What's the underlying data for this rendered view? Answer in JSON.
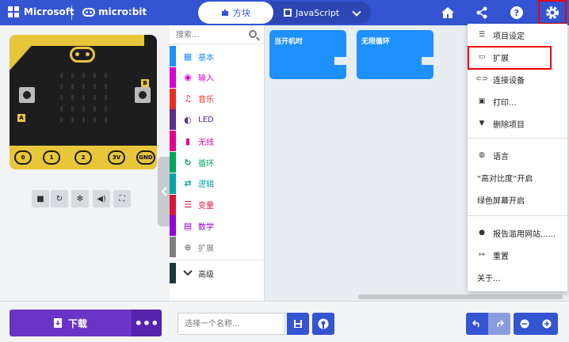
{
  "header": {
    "brand": "Microsoft",
    "product": "micro:bit",
    "tab_blocks": "方块",
    "tab_js": "JavaScript",
    "icons": [
      "home-icon",
      "share-icon",
      "help-icon",
      "gear-icon"
    ]
  },
  "toolbox": {
    "search_placeholder": "搜索...",
    "categories": [
      {
        "label": "基本",
        "color": "#1e90ff",
        "icon": "grid"
      },
      {
        "label": "输入",
        "color": "#d400d4",
        "icon": "circle"
      },
      {
        "label": "音乐",
        "color": "#e63022",
        "icon": "headphones"
      },
      {
        "label": "LED",
        "color": "#5c2d91",
        "icon": "toggle"
      },
      {
        "label": "无线",
        "color": "#e3008c",
        "icon": "signal"
      },
      {
        "label": "循环",
        "color": "#00a65a",
        "icon": "loop"
      },
      {
        "label": "逻辑",
        "color": "#00a4a6",
        "icon": "shuffle"
      },
      {
        "label": "变量",
        "color": "#dc143c",
        "icon": "list"
      },
      {
        "label": "数学",
        "color": "#9400d3",
        "icon": "calculator"
      },
      {
        "label": "扩展",
        "color": "#7f7f7f",
        "icon": "plus"
      }
    ],
    "advanced": {
      "label": "高级",
      "color": "#1a3a3a"
    }
  },
  "workspace": {
    "blocks": [
      {
        "label": "当开机时",
        "color": "#1e90ff"
      },
      {
        "label": "无限循环",
        "color": "#1e90ff"
      }
    ]
  },
  "settings_menu": {
    "items": [
      {
        "label": "项目设定",
        "icon": "sliders-icon"
      },
      {
        "label": "扩展",
        "icon": "drive-icon"
      },
      {
        "label": "连接设备",
        "icon": "link-icon"
      },
      {
        "label": "打印...",
        "icon": "print-icon"
      },
      {
        "label": "删除项目",
        "icon": "trash-icon"
      },
      {
        "label": "语言",
        "icon": "globe-icon"
      },
      {
        "label": "“高对比度”开启",
        "icon": ""
      },
      {
        "label": "绿色屏幕开启",
        "icon": ""
      },
      {
        "label": "报告滥用网站......",
        "icon": "alert-icon"
      },
      {
        "label": "重置",
        "icon": "signout-icon"
      },
      {
        "label": "关于...",
        "icon": ""
      }
    ]
  },
  "simulator": {
    "pins": [
      "0",
      "1",
      "2",
      "3V",
      "GND"
    ],
    "button_a": "A",
    "button_b": "B",
    "toolbar": [
      "stop-icon",
      "restart-icon",
      "debug-icon",
      "sound-icon",
      "fullscreen-icon"
    ]
  },
  "footer": {
    "download_label": "下载",
    "more_label": "•••",
    "name_placeholder": "选择一个名称..."
  },
  "colors": {
    "header": "#3454d1",
    "download": "#6a34c6",
    "highlight": "#e00000"
  }
}
